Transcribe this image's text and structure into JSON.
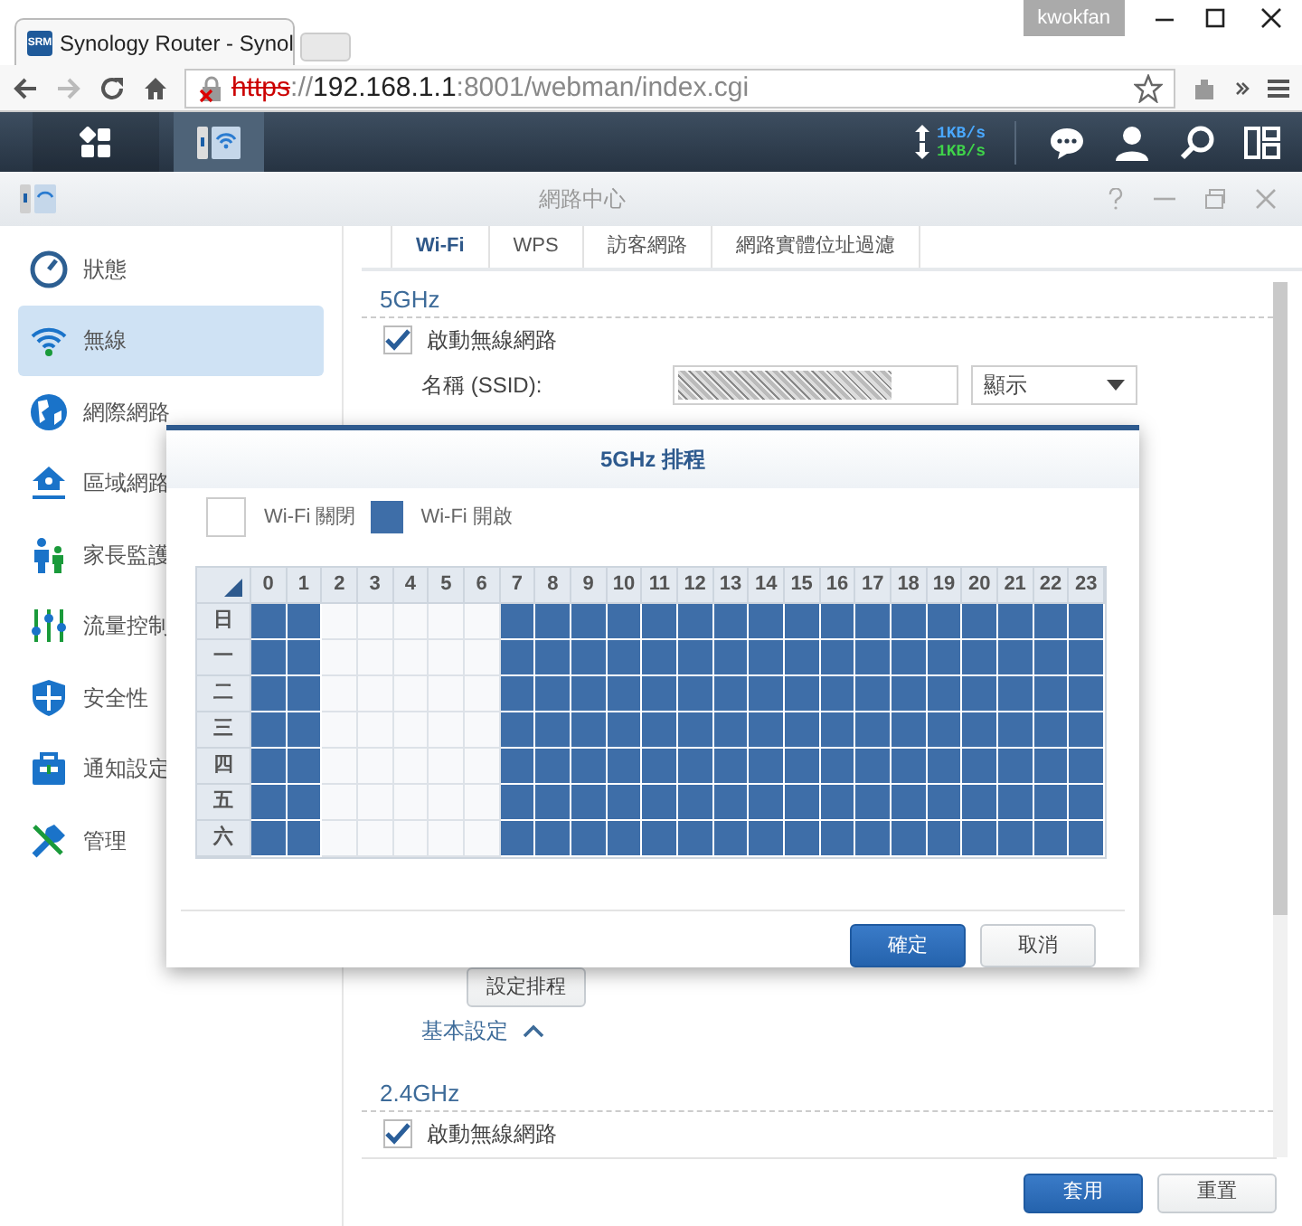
{
  "browser": {
    "tab_favicon": "SRM",
    "tab_title": "Synology Router - Synol",
    "user": "kwokfan",
    "url": {
      "insecure": true,
      "scheme": "https",
      "separator": "://",
      "host": "192.168.1.1",
      "path": ":8001/webman/index.cgi"
    }
  },
  "taskbar": {
    "upload": "1KB/s",
    "download": "1KB/s"
  },
  "window": {
    "title": "網路中心"
  },
  "sidebar": {
    "items": [
      {
        "label": "狀態",
        "selected": false
      },
      {
        "label": "無線",
        "selected": true
      },
      {
        "label": "網際網路",
        "selected": false
      },
      {
        "label": "區域網路",
        "selected": false
      },
      {
        "label": "家長監護",
        "selected": false
      },
      {
        "label": "流量控制",
        "selected": false
      },
      {
        "label": "安全性",
        "selected": false
      },
      {
        "label": "通知設定",
        "selected": false
      },
      {
        "label": "管理",
        "selected": false
      }
    ]
  },
  "tabs": [
    {
      "label": "Wi-Fi",
      "selected": true
    },
    {
      "label": "WPS",
      "selected": false
    },
    {
      "label": "訪客網路",
      "selected": false
    },
    {
      "label": "網路實體位址過濾",
      "selected": false
    }
  ],
  "band_5g": {
    "heading": "5GHz",
    "enable": {
      "label": "啟動無線網路",
      "checked": true
    },
    "ssid_label": "名稱 (SSID):",
    "ssid_visibility": "顯示",
    "schedule_button": "設定排程",
    "basic_settings": {
      "label": "基本設定",
      "expanded": true
    }
  },
  "band_24g": {
    "heading": "2.4GHz",
    "enable": {
      "label": "啟動無線網路",
      "checked": true
    }
  },
  "footer_buttons": [
    {
      "label": "套用",
      "kind": "primary"
    },
    {
      "label": "重置",
      "kind": "secondary"
    }
  ],
  "dialog": {
    "title": "5GHz 排程",
    "legend": [
      {
        "label": "Wi-Fi 關閉",
        "on": false
      },
      {
        "label": "Wi-Fi 開啟",
        "on": true
      }
    ],
    "hours": [
      "0",
      "1",
      "2",
      "3",
      "4",
      "5",
      "6",
      "7",
      "8",
      "9",
      "10",
      "11",
      "12",
      "13",
      "14",
      "15",
      "16",
      "17",
      "18",
      "19",
      "20",
      "21",
      "22",
      "23"
    ],
    "days": [
      {
        "label": "日",
        "slots": [
          true,
          true,
          false,
          false,
          false,
          false,
          false,
          true,
          true,
          true,
          true,
          true,
          true,
          true,
          true,
          true,
          true,
          true,
          true,
          true,
          true,
          true,
          true,
          true
        ]
      },
      {
        "label": "一",
        "slots": [
          true,
          true,
          false,
          false,
          false,
          false,
          false,
          true,
          true,
          true,
          true,
          true,
          true,
          true,
          true,
          true,
          true,
          true,
          true,
          true,
          true,
          true,
          true,
          true
        ]
      },
      {
        "label": "二",
        "slots": [
          true,
          true,
          false,
          false,
          false,
          false,
          false,
          true,
          true,
          true,
          true,
          true,
          true,
          true,
          true,
          true,
          true,
          true,
          true,
          true,
          true,
          true,
          true,
          true
        ]
      },
      {
        "label": "三",
        "slots": [
          true,
          true,
          false,
          false,
          false,
          false,
          false,
          true,
          true,
          true,
          true,
          true,
          true,
          true,
          true,
          true,
          true,
          true,
          true,
          true,
          true,
          true,
          true,
          true
        ]
      },
      {
        "label": "四",
        "slots": [
          true,
          true,
          false,
          false,
          false,
          false,
          false,
          true,
          true,
          true,
          true,
          true,
          true,
          true,
          true,
          true,
          true,
          true,
          true,
          true,
          true,
          true,
          true,
          true
        ]
      },
      {
        "label": "五",
        "slots": [
          true,
          true,
          false,
          false,
          false,
          false,
          false,
          true,
          true,
          true,
          true,
          true,
          true,
          true,
          true,
          true,
          true,
          true,
          true,
          true,
          true,
          true,
          true,
          true
        ]
      },
      {
        "label": "六",
        "slots": [
          true,
          true,
          false,
          false,
          false,
          false,
          false,
          true,
          true,
          true,
          true,
          true,
          true,
          true,
          true,
          true,
          true,
          true,
          true,
          true,
          true,
          true,
          true,
          true
        ]
      }
    ],
    "buttons": [
      {
        "label": "確定",
        "kind": "primary"
      },
      {
        "label": "取消",
        "kind": "secondary"
      }
    ]
  }
}
